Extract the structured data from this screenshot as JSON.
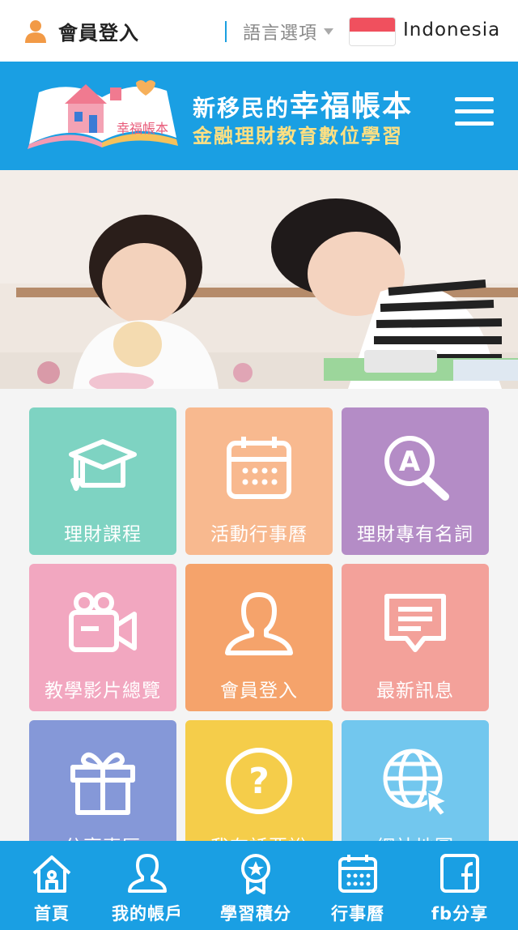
{
  "topbar": {
    "login_label": "會員登入",
    "language_label": "語言選項",
    "language_value": "Indonesia"
  },
  "header": {
    "title_prefix": "新移民的",
    "title_main": "幸福帳本",
    "subtitle": "金融理財教育數位學習",
    "logo_text": "幸福帳本"
  },
  "tiles": [
    {
      "label": "理財課程",
      "icon": "graduation-cap-icon",
      "color": "#7ed3c2"
    },
    {
      "label": "活動行事曆",
      "icon": "calendar-icon",
      "color": "#f8b98f"
    },
    {
      "label": "理財專有名詞",
      "icon": "glossary-search-icon",
      "color": "#b48cc6"
    },
    {
      "label": "教學影片總覽",
      "icon": "video-camera-icon",
      "color": "#f2a7c0"
    },
    {
      "label": "會員登入",
      "icon": "member-icon",
      "color": "#f5a36b"
    },
    {
      "label": "最新訊息",
      "icon": "message-icon",
      "color": "#f3a19a"
    },
    {
      "label": "分享專區",
      "icon": "gift-icon",
      "color": "#8598d8"
    },
    {
      "label": "我有話要說",
      "icon": "question-icon",
      "color": "#f5cd4a"
    },
    {
      "label": "網站地圖",
      "icon": "globe-icon",
      "color": "#72c7ee"
    }
  ],
  "bottom_nav": [
    {
      "label": "首頁",
      "icon": "home-icon"
    },
    {
      "label": "我的帳戶",
      "icon": "account-icon"
    },
    {
      "label": "學習積分",
      "icon": "badge-icon"
    },
    {
      "label": "行事曆",
      "icon": "calendar-icon"
    },
    {
      "label": "fb分享",
      "icon": "facebook-icon"
    }
  ],
  "colors": {
    "brand_blue": "#1a9fe3",
    "accent_yellow": "#ffe082",
    "login_orange": "#f29a46",
    "flag_red": "#f0505e"
  }
}
